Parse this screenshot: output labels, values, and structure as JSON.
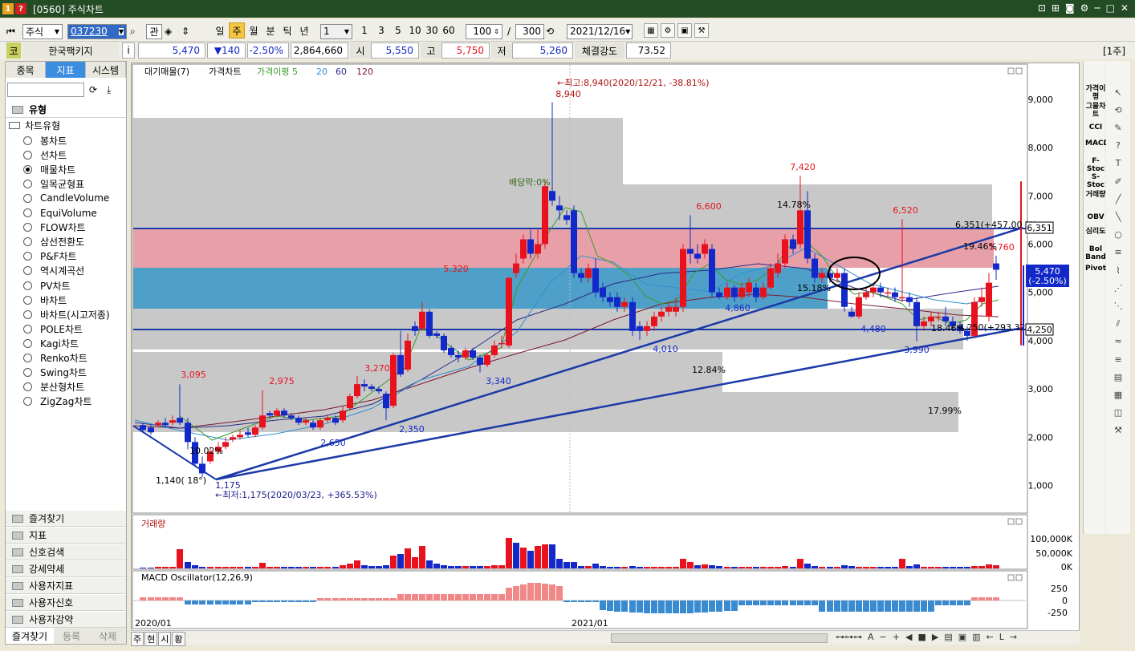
{
  "window": {
    "num": "1",
    "num2": "?",
    "title": "[0560] 주식차트"
  },
  "toolbar": {
    "market": "주식",
    "code": "037230",
    "btn_gwan": "관",
    "periods": [
      "일",
      "주",
      "월",
      "분",
      "틱",
      "년"
    ],
    "active_period": "주",
    "qty_select": "1",
    "quick_nums": [
      "1",
      "3",
      "5",
      "10",
      "30",
      "60"
    ],
    "count": "100",
    "count_max": "300",
    "slash": "/",
    "date": "2021/12/16"
  },
  "quote": {
    "badge": "코",
    "name": "한국팩키지",
    "info": "i",
    "price": "5,470",
    "change": "▼140",
    "rate": "-2.50%",
    "volume": "2,864,660",
    "open_label": "시",
    "open": "5,550",
    "high_label": "고",
    "high": "5,750",
    "low_label": "저",
    "low": "5,260",
    "strength_label": "체결강도",
    "strength": "73.52",
    "period_tag": "[1주]"
  },
  "left": {
    "tabs": [
      "종목",
      "지표",
      "시스템"
    ],
    "active_tab": "지표",
    "group_label": "유형",
    "sub_label": "차트유형",
    "chart_types": [
      "봉차트",
      "선차트",
      "매물차트",
      "일목균형표",
      "CandleVolume",
      "EquiVolume",
      "FLOW차트",
      "삼선전환도",
      "P&F차트",
      "역시계곡선",
      "PV차트",
      "바차트",
      "바차트(시고저종)",
      "POLE차트",
      "Kagi차트",
      "Renko차트",
      "Swing차트",
      "분산형차트",
      "ZigZag차트"
    ],
    "selected_type": "매물차트",
    "folders": [
      "즐겨찾기",
      "지표",
      "신호검색",
      "강세약세",
      "사용자지표",
      "사용자신호",
      "사용자강약"
    ],
    "footer": [
      "즐겨찾기",
      "등록",
      "삭제"
    ]
  },
  "chart": {
    "legend": [
      "대기매물(7)",
      "가격차트",
      "가격이평 5",
      "20",
      "60",
      "120"
    ],
    "y_ticks": [
      "9,000",
      "8,000",
      "7,000",
      "6,000",
      "5,000",
      "4,000",
      "3,000",
      "2,000",
      "1,000"
    ],
    "annotations": {
      "high": "←최고:8,940(2020/12/21, -38.81%)",
      "high_val": "8,940",
      "low": "←최저:1,175(2020/03/23, +365.53%)",
      "low_val": "1,175",
      "low_left": "1,140( 18°)",
      "dividend": "배당락:0%",
      "labels": [
        "3,095",
        "2,975",
        "3,270",
        "5,320",
        "6,600",
        "7,420",
        "6,520",
        "5,760",
        "2,650",
        "2,350",
        "3,340",
        "4,010",
        "4,860",
        "4,480",
        "3,990"
      ],
      "pcts": [
        "14.78%",
        "19.46%",
        "15.18%",
        "12.84%",
        "17.99%",
        "18.46%",
        "10.02%"
      ],
      "line_label": "6,351(+457.00 %)",
      "line_label2": "4,250(+293.32 %)"
    },
    "price_box": "5,470",
    "price_box_pct": "(-2.50%)",
    "tag_6351": "6,351",
    "tag_4250": "4,250",
    "x_labels": [
      "2020/01",
      "2021/01"
    ],
    "volume_title": "거래량",
    "vol_ticks": [
      "100,000K",
      "50,000K",
      "0K"
    ],
    "macd_title": "MACD Oscillator(12,26,9)",
    "macd_ticks": [
      "250",
      "0",
      "-250"
    ]
  },
  "bottom": {
    "tabs": [
      "주",
      "현",
      "시",
      "황"
    ]
  },
  "right_tools": [
    "가격이평",
    "그물차트",
    "CCI",
    "MACD",
    "F-Stoc",
    "S-Stoc",
    "거래량",
    "OBV",
    "심리도",
    "Bol Band",
    "Pivot"
  ],
  "colors": {
    "up": "#e8121e",
    "down": "#1228c8",
    "accent": "#316ac5"
  }
}
